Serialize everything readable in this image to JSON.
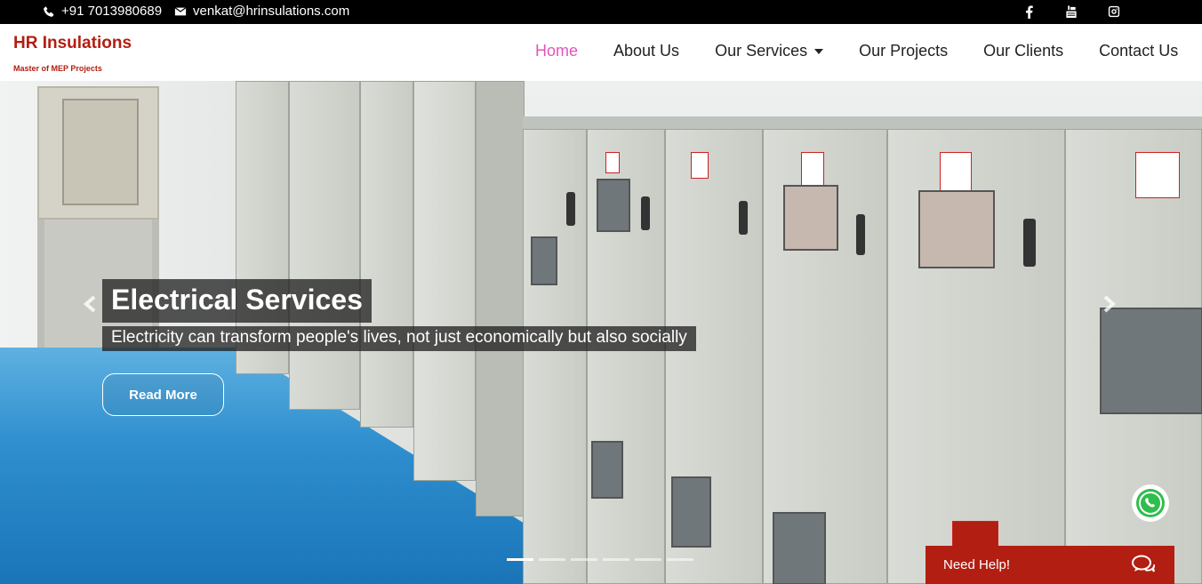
{
  "topbar": {
    "phone": "+91 7013980689",
    "email": "venkat@hrinsulations.com",
    "phone_icon": "phone-icon",
    "email_icon": "envelope-icon",
    "social": [
      "facebook-icon",
      "youtube-icon",
      "instagram-icon"
    ]
  },
  "brand": {
    "name": "HR Insulations",
    "tagline": "Master of MEP Projects",
    "color": "#b21e12"
  },
  "nav": {
    "home": "Home",
    "about": "About Us",
    "services": "Our Services",
    "projects": "Our Projects",
    "clients": "Our Clients",
    "contact": "Contact Us",
    "active_color": "#e455b8"
  },
  "hero": {
    "title": "Electrical Services",
    "subtitle": "Electricity can transform people's lives, not just economically but also socially",
    "button": "Read More",
    "slide_count": 6,
    "active_slide": 1
  },
  "help": {
    "label": "Need Help!",
    "color": "#b21e12"
  }
}
